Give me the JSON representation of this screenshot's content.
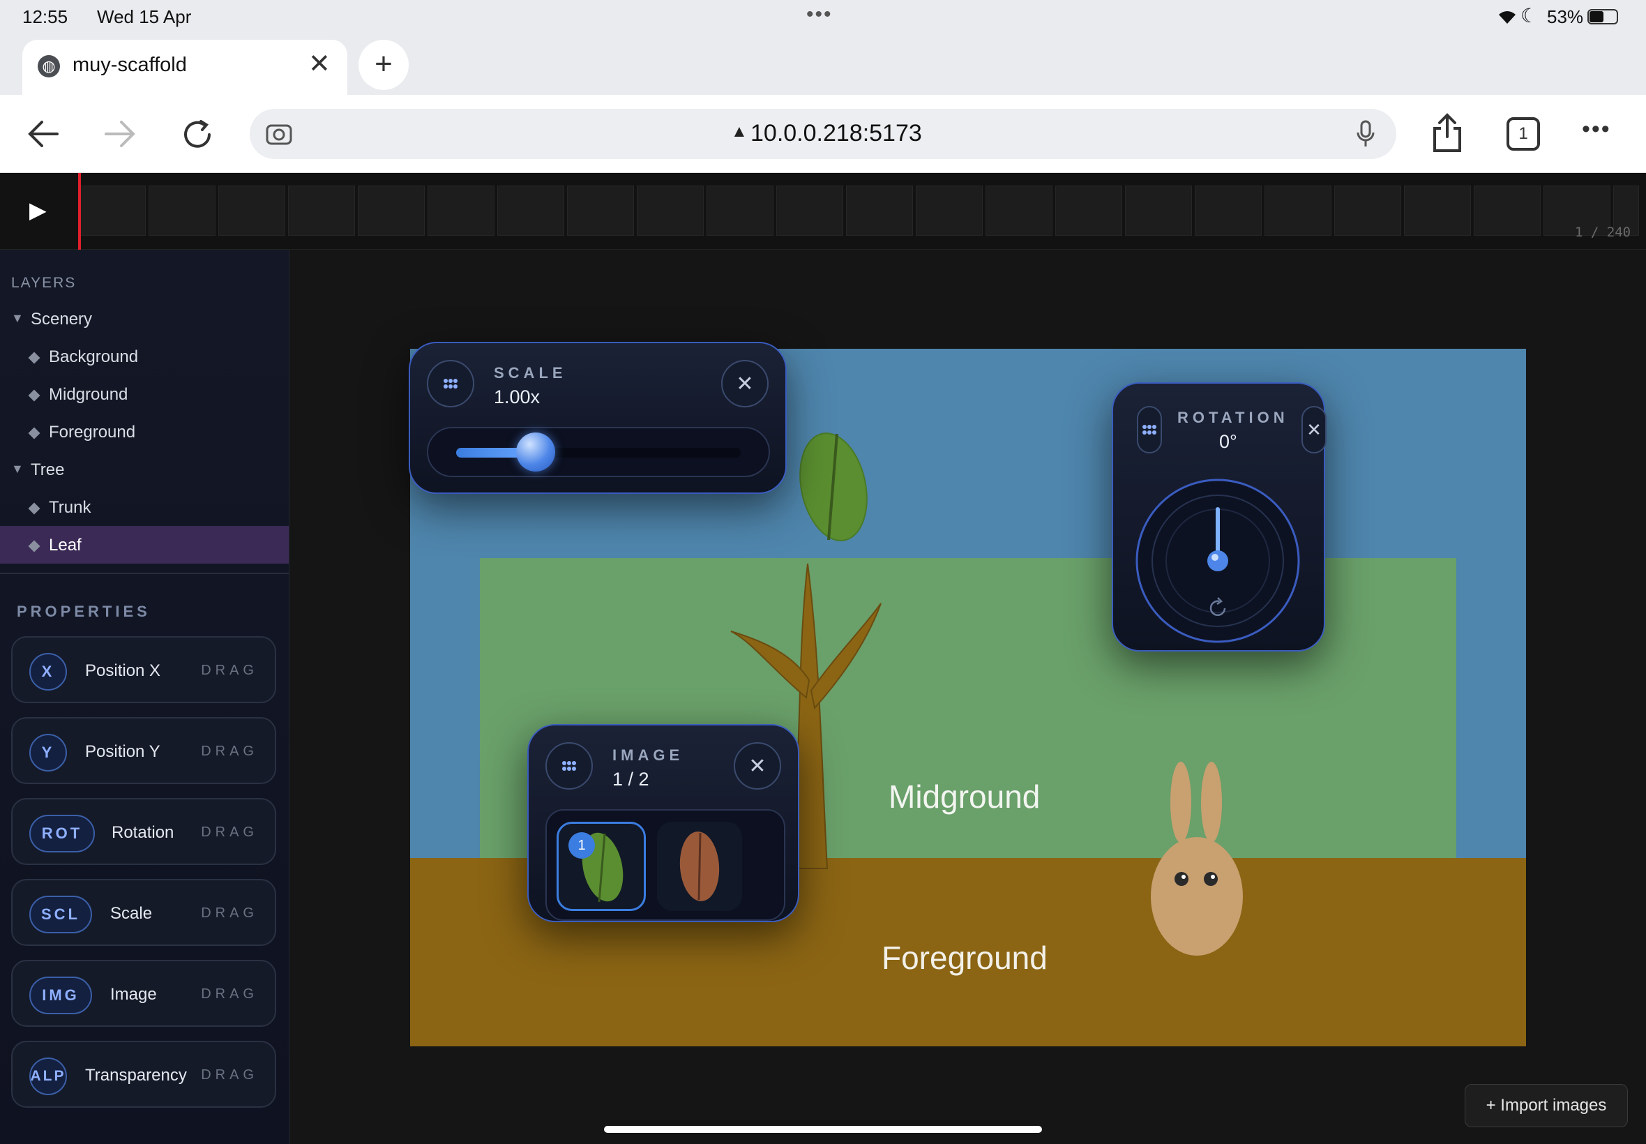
{
  "status_bar": {
    "time": "12:55",
    "date": "Wed 15 Apr",
    "battery": "53%"
  },
  "browser": {
    "tab_title": "muy-scaffold",
    "url": "10.0.0.218:5173",
    "tab_count": "1"
  },
  "timeline": {
    "frame_counter": "1 / 240"
  },
  "layers": {
    "heading": "LAYERS",
    "groups": [
      {
        "name": "Scenery",
        "children": [
          "Background",
          "Midground",
          "Foreground"
        ]
      },
      {
        "name": "Tree",
        "children": [
          "Trunk",
          "Leaf"
        ]
      }
    ],
    "selected": "Leaf"
  },
  "properties": {
    "heading": "PROPERTIES",
    "drag_label": "DRAG",
    "items": [
      {
        "badge": "X",
        "label": "Position X"
      },
      {
        "badge": "Y",
        "label": "Position Y"
      },
      {
        "badge": "ROT",
        "label": "Rotation"
      },
      {
        "badge": "SCL",
        "label": "Scale"
      },
      {
        "badge": "IMG",
        "label": "Image"
      },
      {
        "badge": "ALP",
        "label": "Transparency"
      }
    ]
  },
  "scale_panel": {
    "title": "SCALE",
    "value": "1.00x",
    "slider_fraction": 0.28
  },
  "rotation_panel": {
    "title": "ROTATION",
    "value": "0°"
  },
  "image_panel": {
    "title": "IMAGE",
    "value": "1 / 2",
    "selected_badge": "1"
  },
  "stage": {
    "midground_label": "Midground",
    "foreground_label": "Foreground"
  },
  "import_button": "+ Import images",
  "colors": {
    "accent": "#3a5cc0",
    "selected_layer": "#3b2a55",
    "sky": "#4f86ad",
    "midground": "#6aa06a",
    "foreground": "#8b6514"
  }
}
